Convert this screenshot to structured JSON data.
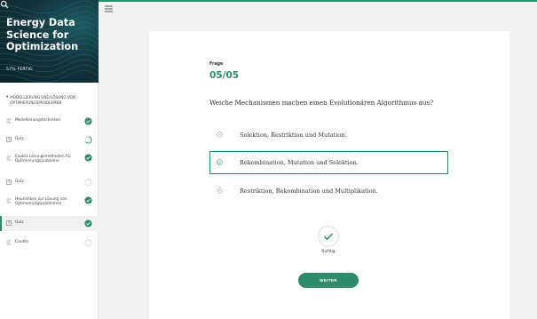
{
  "course": {
    "title": "Energy Data Science for Optimization",
    "progress_text": "57% FERTIG"
  },
  "sidebar": {
    "section_title": "MODELLIERUNG UND LÖSUNG VON OPTIMIERUNGSPROBLEMEN",
    "items": [
      {
        "label": "Modellierungstechniken",
        "type": "lesson",
        "status": "complete"
      },
      {
        "label": "Quiz",
        "type": "quiz",
        "status": "in-progress"
      },
      {
        "label": "Exakte Lösungsmethoden für Optimierungsprobleme",
        "type": "lesson",
        "status": "complete"
      },
      {
        "label": "Quiz",
        "type": "quiz",
        "status": "not-started"
      },
      {
        "label": "Heuristiken zur Lösung von Optimierungsproblemen",
        "type": "lesson",
        "status": "complete"
      },
      {
        "label": "Quiz",
        "type": "quiz",
        "status": "complete"
      },
      {
        "label": "Credits",
        "type": "lesson",
        "status": "not-started"
      }
    ]
  },
  "quiz": {
    "label": "Frage",
    "number": "05/05",
    "question": "Weiche Mechanismen machen einen Evolutionären Algorithmus aus?",
    "options": [
      {
        "text": "Selektion, Restriktion und Mutation."
      },
      {
        "text": "Rekombination, Mutation und Selektion."
      },
      {
        "text": "Restriktion, Rekombination und Multiplikation."
      }
    ],
    "result_label": "Richtig",
    "next_label": "WEITER"
  },
  "colors": {
    "accent": "#2e8b6b",
    "hero_bg": "#12343d"
  }
}
